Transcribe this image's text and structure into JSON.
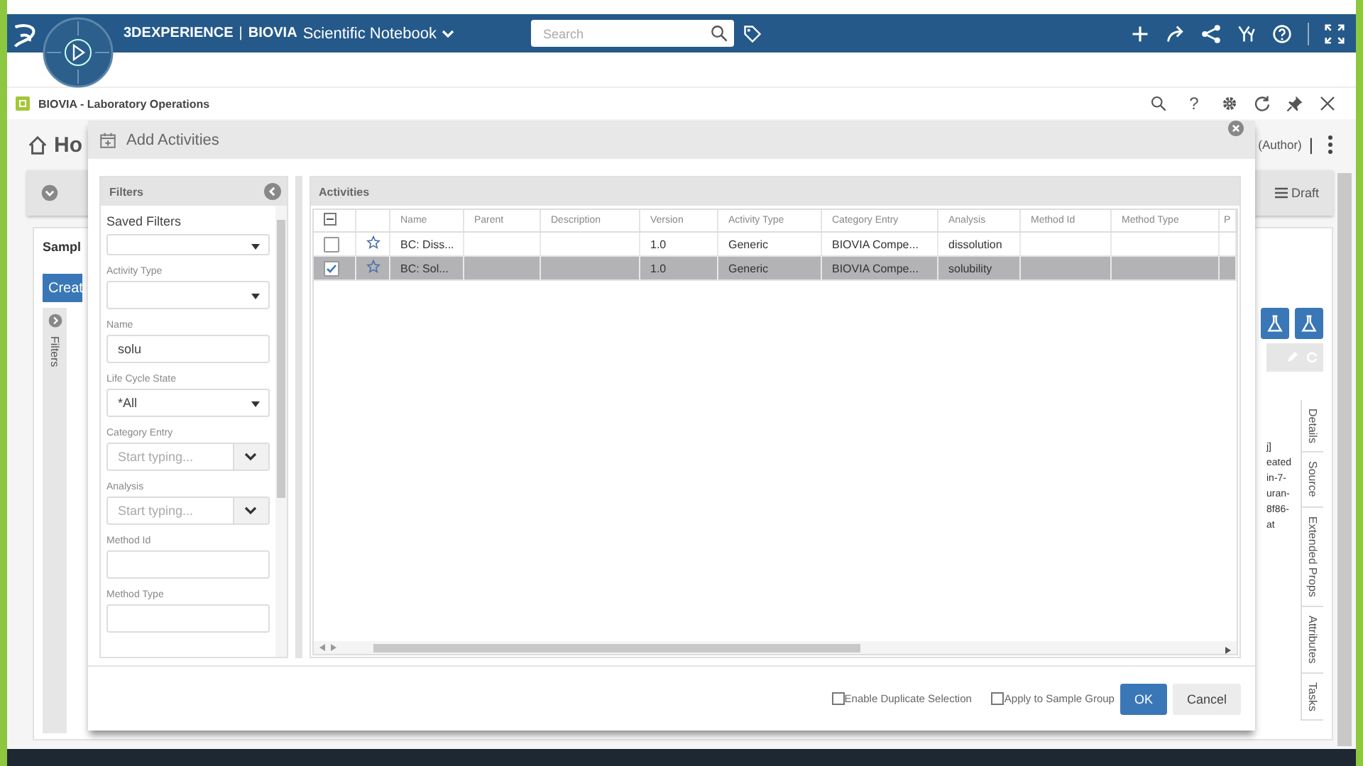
{
  "top_bar": {
    "brand": "3DEXPERIENCE",
    "separator": "|",
    "product": "BIOVIA",
    "app": "Scientific Notebook",
    "search": {
      "placeholder": "Search"
    }
  },
  "app_bar": {
    "title": "BIOVIA - Laboratory Operations",
    "help": "?"
  },
  "page": {
    "title": "Ho",
    "role": "(Author)",
    "separator": "|",
    "state": "Draft",
    "section": "Sampl",
    "create_button": "Creat",
    "filters_tab": "Filters",
    "fragments": [
      "j]",
      "eated",
      "in-7-",
      "uran-",
      "8f86-",
      "at"
    ],
    "side_tabs": [
      "Details",
      "Source",
      "Extended Props",
      "Attributes",
      "Tasks"
    ]
  },
  "dialog": {
    "title": "Add Activities",
    "filters": {
      "title": "Filters",
      "fields": [
        {
          "kind": "saved",
          "label": "Saved Filters"
        },
        {
          "kind": "select",
          "label": "Activity Type"
        },
        {
          "kind": "text",
          "label": "Name",
          "value": "solu"
        },
        {
          "kind": "select",
          "label": "Life Cycle State",
          "value": "*All"
        },
        {
          "kind": "combo",
          "label": "Category Entry",
          "placeholder": "Start typing..."
        },
        {
          "kind": "combo",
          "label": "Analysis",
          "placeholder": "Start typing..."
        },
        {
          "kind": "text",
          "label": "Method Id"
        },
        {
          "kind": "text",
          "label": "Method Type"
        }
      ]
    },
    "activities": {
      "title": "Activities",
      "select_all_partial": true,
      "columns": [
        "Name",
        "Parent",
        "Description",
        "Version",
        "Activity Type",
        "Category Entry",
        "Analysis",
        "Method Id",
        "Method Type",
        "P"
      ],
      "rows": [
        {
          "selected": false,
          "checked": false,
          "name": "BC: Diss...",
          "version": "1.0",
          "activity_type": "Generic",
          "category_entry": "BIOVIA Compe...",
          "analysis": "dissolution"
        },
        {
          "selected": true,
          "checked": true,
          "name": "BC: Sol...",
          "version": "1.0",
          "activity_type": "Generic",
          "category_entry": "BIOVIA Compe...",
          "analysis": "solubility"
        }
      ]
    },
    "options": [
      {
        "label": "Enable Duplicate Selection",
        "checked": false
      },
      {
        "label": "Apply to Sample Group",
        "checked": false
      }
    ],
    "buttons": [
      {
        "label": "OK",
        "kind": "primary"
      },
      {
        "label": "Cancel",
        "kind": "secondary"
      }
    ]
  }
}
